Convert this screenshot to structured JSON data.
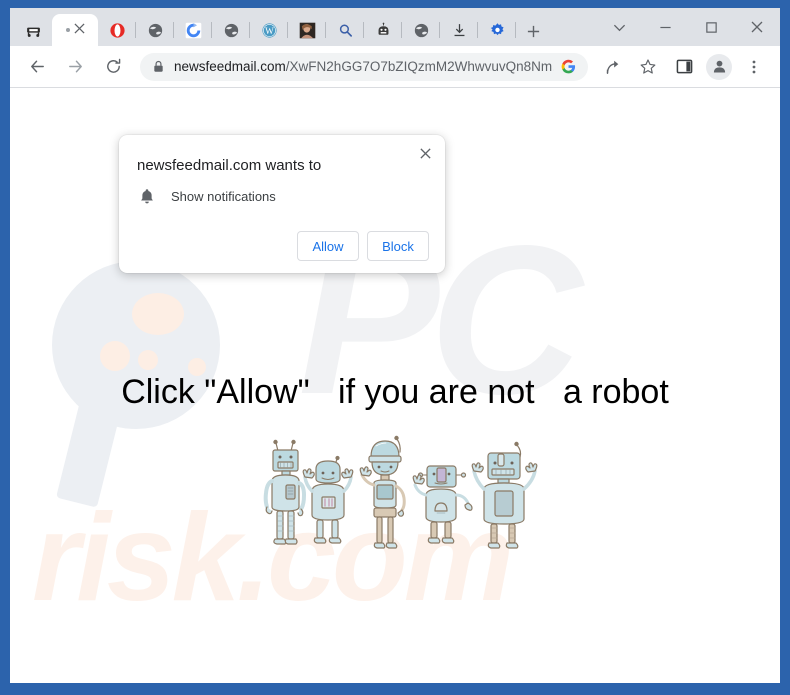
{
  "window": {
    "frame_color": "#2c63ac",
    "controls": [
      {
        "name": "tab-search",
        "glyph": "chevron-down"
      },
      {
        "name": "minimize",
        "glyph": "minimize"
      },
      {
        "name": "maximize",
        "glyph": "maximize"
      },
      {
        "name": "close",
        "glyph": "close"
      }
    ]
  },
  "tabstrip": {
    "pinned_tabs": [
      {
        "name": "bench-icon",
        "title": "bench"
      },
      {
        "name": "opera-icon",
        "title": "Opera"
      },
      {
        "name": "globe-icon",
        "title": "globe"
      },
      {
        "name": "chrome-sync-icon",
        "title": "sync"
      },
      {
        "name": "globe-icon",
        "title": "globe"
      },
      {
        "name": "wordpress-icon",
        "title": "WordPress"
      },
      {
        "name": "photo-thumbnail-icon",
        "title": "photo"
      },
      {
        "name": "search-icon",
        "title": "search"
      },
      {
        "name": "robot-icon",
        "title": "robot"
      },
      {
        "name": "globe-icon",
        "title": "globe"
      },
      {
        "name": "download-icon",
        "title": "download"
      },
      {
        "name": "gear-icon",
        "title": "settings"
      }
    ],
    "active_tab": {
      "label": "",
      "close_label": "×"
    },
    "new_tab_label": "+"
  },
  "toolbar": {
    "back_label": "←",
    "forward_label": "→",
    "reload_label": "⟳",
    "url_domain": "newsfeedmail.com",
    "url_path": "/XwFN2hGG7O7bZIQzmM2WhwvuvQn8Nm…",
    "lock_icon": "lock-icon",
    "right_icons": [
      {
        "name": "google-icon"
      },
      {
        "name": "share-icon"
      },
      {
        "name": "bookmark-star-icon"
      },
      {
        "name": "side-panel-icon"
      },
      {
        "name": "profile-avatar-icon"
      },
      {
        "name": "more-menu-icon"
      }
    ]
  },
  "permission_dialog": {
    "title": "newsfeedmail.com wants to",
    "permission_icon": "bell-icon",
    "permission_text": "Show notifications",
    "allow_label": "Allow",
    "block_label": "Block",
    "close_label": "×",
    "accent_color": "#1a73e8"
  },
  "page": {
    "headline": "Click \"Allow\"   if you are not   a robot",
    "watermark_pc": "PC",
    "watermark_risk": "risk.com",
    "robot_count": 5,
    "robot_body_color": "#bcd9e0",
    "robot_outline_color": "#7a6a5a"
  }
}
